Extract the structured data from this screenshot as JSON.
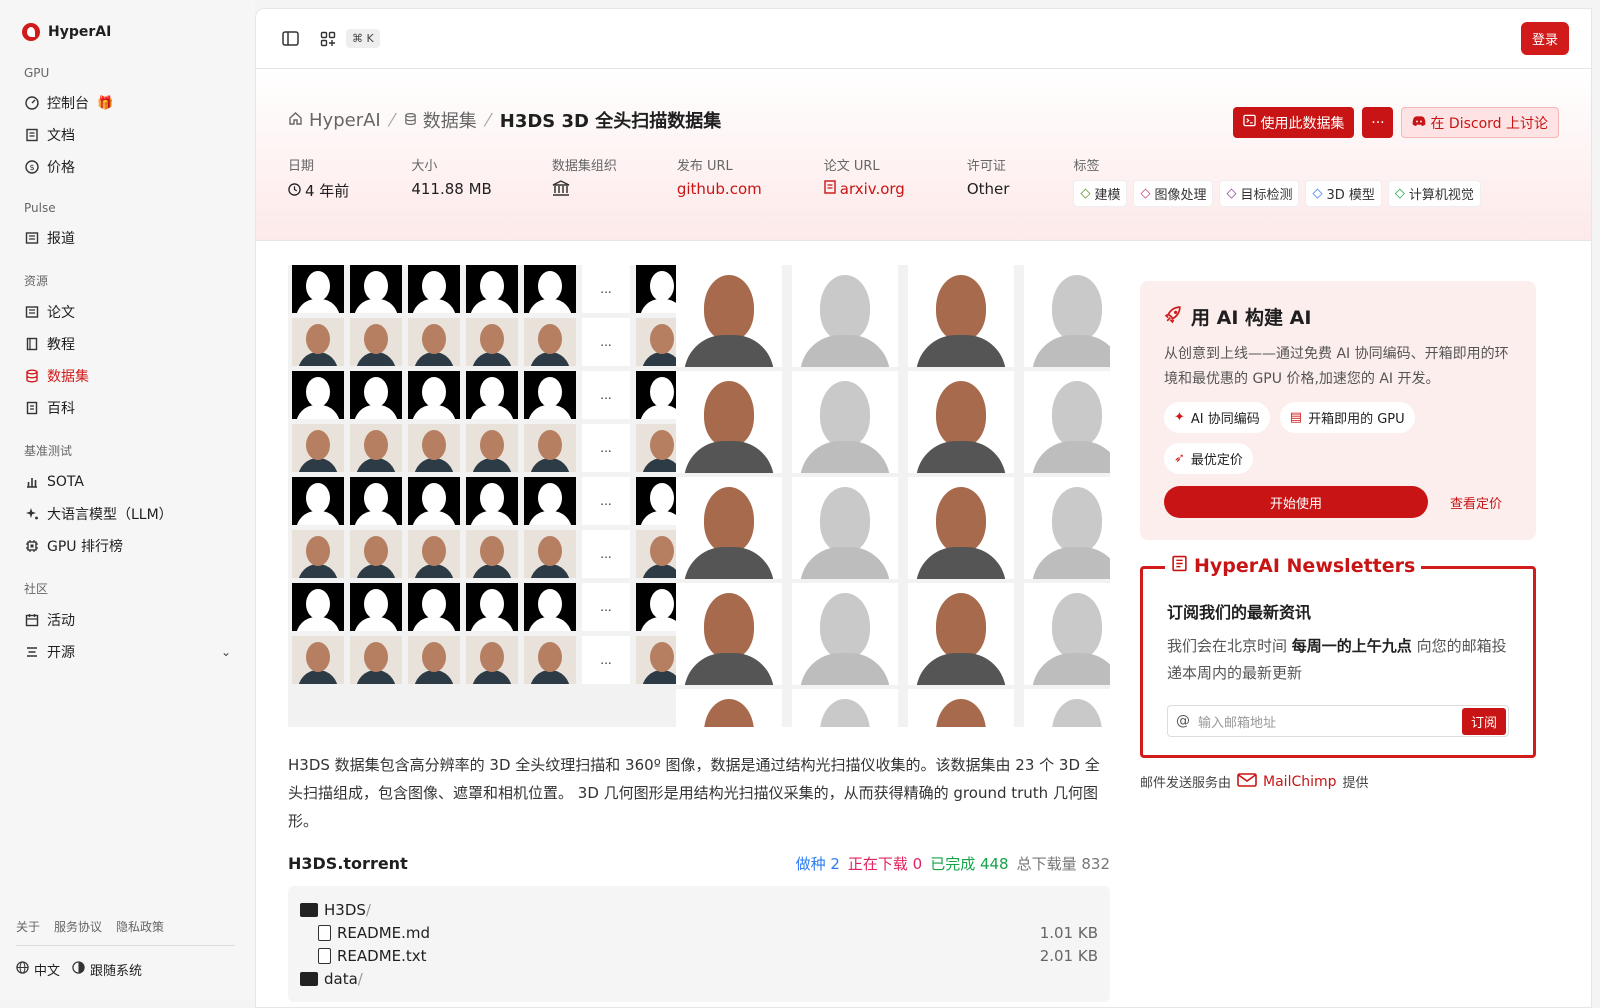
{
  "app": {
    "name": "HyperAI"
  },
  "sidebar": {
    "sections": [
      {
        "title": "GPU",
        "items": [
          {
            "label": "控制台"
          },
          {
            "label": "文档"
          },
          {
            "label": "价格"
          }
        ]
      },
      {
        "title": "Pulse",
        "items": [
          {
            "label": "报道"
          }
        ]
      },
      {
        "title": "资源",
        "items": [
          {
            "label": "论文"
          },
          {
            "label": "教程"
          },
          {
            "label": "数据集"
          },
          {
            "label": "百科"
          }
        ]
      },
      {
        "title": "基准测试",
        "items": [
          {
            "label": "SOTA"
          },
          {
            "label": "大语言模型（LLM）"
          },
          {
            "label": "GPU 排行榜"
          }
        ]
      },
      {
        "title": "社区",
        "items": [
          {
            "label": "活动"
          },
          {
            "label": "开源"
          }
        ]
      }
    ],
    "footer_links": [
      "关于",
      "服务协议",
      "隐私政策"
    ],
    "language": "中文",
    "theme": "跟随系统"
  },
  "topbar": {
    "shortcut": "⌘ K",
    "login_label": "登录"
  },
  "breadcrumb": {
    "home": "HyperAI",
    "section": "数据集",
    "current": "H3DS 3D 全头扫描数据集"
  },
  "actions": {
    "use_dataset": "使用此数据集",
    "more": "···",
    "discord": "在 Discord 上讨论"
  },
  "meta": {
    "date_label": "日期",
    "date_value": "4 年前",
    "size_label": "大小",
    "size_value": "411.88 MB",
    "org_label": "数据集组织",
    "release_label": "发布 URL",
    "release_value": "github.com",
    "paper_label": "论文 URL",
    "paper_value": "arxiv.org",
    "license_label": "许可证",
    "license_value": "Other",
    "tags_label": "标签",
    "tags": [
      {
        "label": "建模",
        "color": "#5a8f1f"
      },
      {
        "label": "图像处理",
        "color": "#c2417a"
      },
      {
        "label": "目标检测",
        "color": "#8b3f9c"
      },
      {
        "label": "3D 模型",
        "color": "#2f7cf6"
      },
      {
        "label": "计算机视觉",
        "color": "#16a34a"
      }
    ]
  },
  "figure": {
    "ellipsis": "..."
  },
  "description": "H3DS 数据集包含高分辨率的 3D 全头纹理扫描和 360º 图像，数据是通过结构光扫描仪收集的。该数据集由 23 个 3D 全头扫描组成，包含图像、遮罩和相机位置。 3D 几何图形是用结构光扫描仪采集的，从而获得精确的 ground truth 几何图形。",
  "torrent": {
    "title": "H3DS.torrent",
    "seeding": "做种 2",
    "downloading": "正在下载 0",
    "completed": "已完成 448",
    "total": "总下载量 832",
    "files": [
      {
        "name": "H3DS",
        "suffix": "/",
        "type": "folder",
        "size": ""
      },
      {
        "name": "README.md",
        "suffix": "",
        "type": "file",
        "size": "1.01 KB"
      },
      {
        "name": "README.txt",
        "suffix": "",
        "type": "file",
        "size": "2.01 KB"
      },
      {
        "name": "data",
        "suffix": "/",
        "type": "folder",
        "size": ""
      }
    ]
  },
  "promo": {
    "title": "用 AI 构建 AI",
    "text": "从创意到上线——通过免费 AI 协同编码、开箱即用的环境和最优惠的 GPU 价格,加速您的 AI 开发。",
    "chips": [
      "AI 协同编码",
      "开箱即用的 GPU",
      "最优定价"
    ],
    "start": "开始使用",
    "pricing": "查看定价"
  },
  "newsletter": {
    "legend": "HyperAI Newsletters",
    "title": "订阅我们的最新资讯",
    "text_pre": "我们会在北京时间 ",
    "text_bold": "每周一的上午九点",
    "text_post": " 向您的邮箱投递本周内的最新更新",
    "placeholder": "输入邮箱地址",
    "subscribe": "订阅",
    "provider_pre": "邮件发送服务由",
    "provider": "MailChimp",
    "provider_post": "提供"
  }
}
